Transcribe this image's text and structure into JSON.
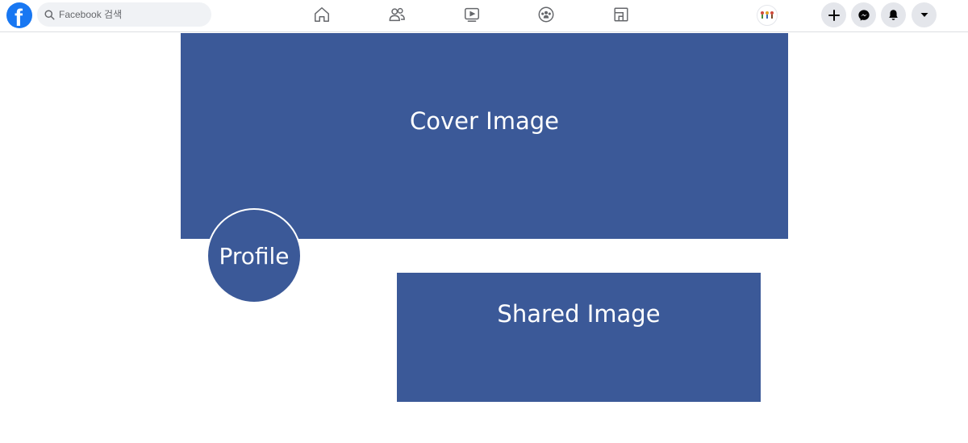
{
  "topbar": {
    "logo_glyph": "f",
    "search": {
      "placeholder": "Facebook 검색"
    },
    "nav_icons": [
      "home-icon",
      "friends-icon",
      "watch-icon",
      "groups-icon",
      "gaming-icon"
    ],
    "action_icons": [
      "plus-icon",
      "messenger-icon",
      "bell-icon",
      "caret-down-icon"
    ]
  },
  "main": {
    "cover_label": "Cover Image",
    "profile_label": "Profile",
    "shared_label": "Shared Image"
  },
  "colors": {
    "brand_blue": "#1877f2",
    "placeholder_blue": "#3b5998",
    "icon_gray": "#65676b",
    "button_bg": "#e4e6eb",
    "search_bg": "#f0f2f5"
  }
}
